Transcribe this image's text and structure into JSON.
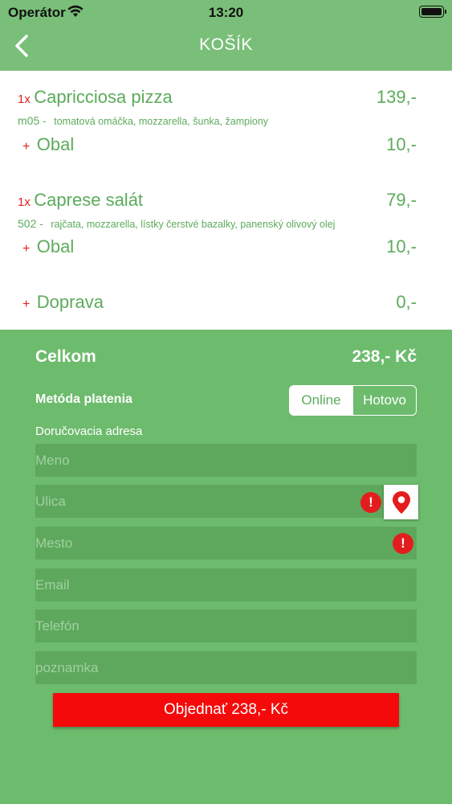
{
  "status_bar": {
    "carrier": "Operátor",
    "time": "13:20"
  },
  "header": {
    "title": "KOŠÍK"
  },
  "cart": {
    "items": [
      {
        "qty": "1x",
        "name": "Capricciosa pizza",
        "price": "139,-",
        "code": "m05 -",
        "description": "tomatová omáčka, mozzarella, šunka, žampiony",
        "extra": {
          "plus": "+",
          "name": "Obal",
          "price": "10,-"
        }
      },
      {
        "qty": "1x",
        "name": "Caprese salát",
        "price": "79,-",
        "code": "502 -",
        "description": "rajčata, mozzarella, lístky čerstvé bazalky, panenský olivový olej",
        "extra": {
          "plus": "+",
          "name": "Obal",
          "price": "10,-"
        }
      }
    ],
    "delivery": {
      "plus": "+",
      "name": "Doprava",
      "price": "0,-"
    }
  },
  "summary": {
    "total_label": "Celkom",
    "total_value": "238,- Kč",
    "payment_label": "Metóda platenia",
    "payment_options": [
      "Online",
      "Hotovo"
    ],
    "address_label": "Doručovacia adresa",
    "fields": {
      "name_placeholder": "Meno",
      "street_placeholder": "Ulica",
      "city_placeholder": "Mesto",
      "email_placeholder": "Email",
      "phone_placeholder": "Telefón",
      "note_placeholder": "poznamka"
    },
    "warning_glyph": "!",
    "order_button": "Objednať 238,- Kč"
  },
  "colors": {
    "header": "#79bf79",
    "background": "#6dbb6d",
    "accent_green": "#5cab5c",
    "red": "#e31d1d",
    "order_button": "#f40a0a"
  }
}
